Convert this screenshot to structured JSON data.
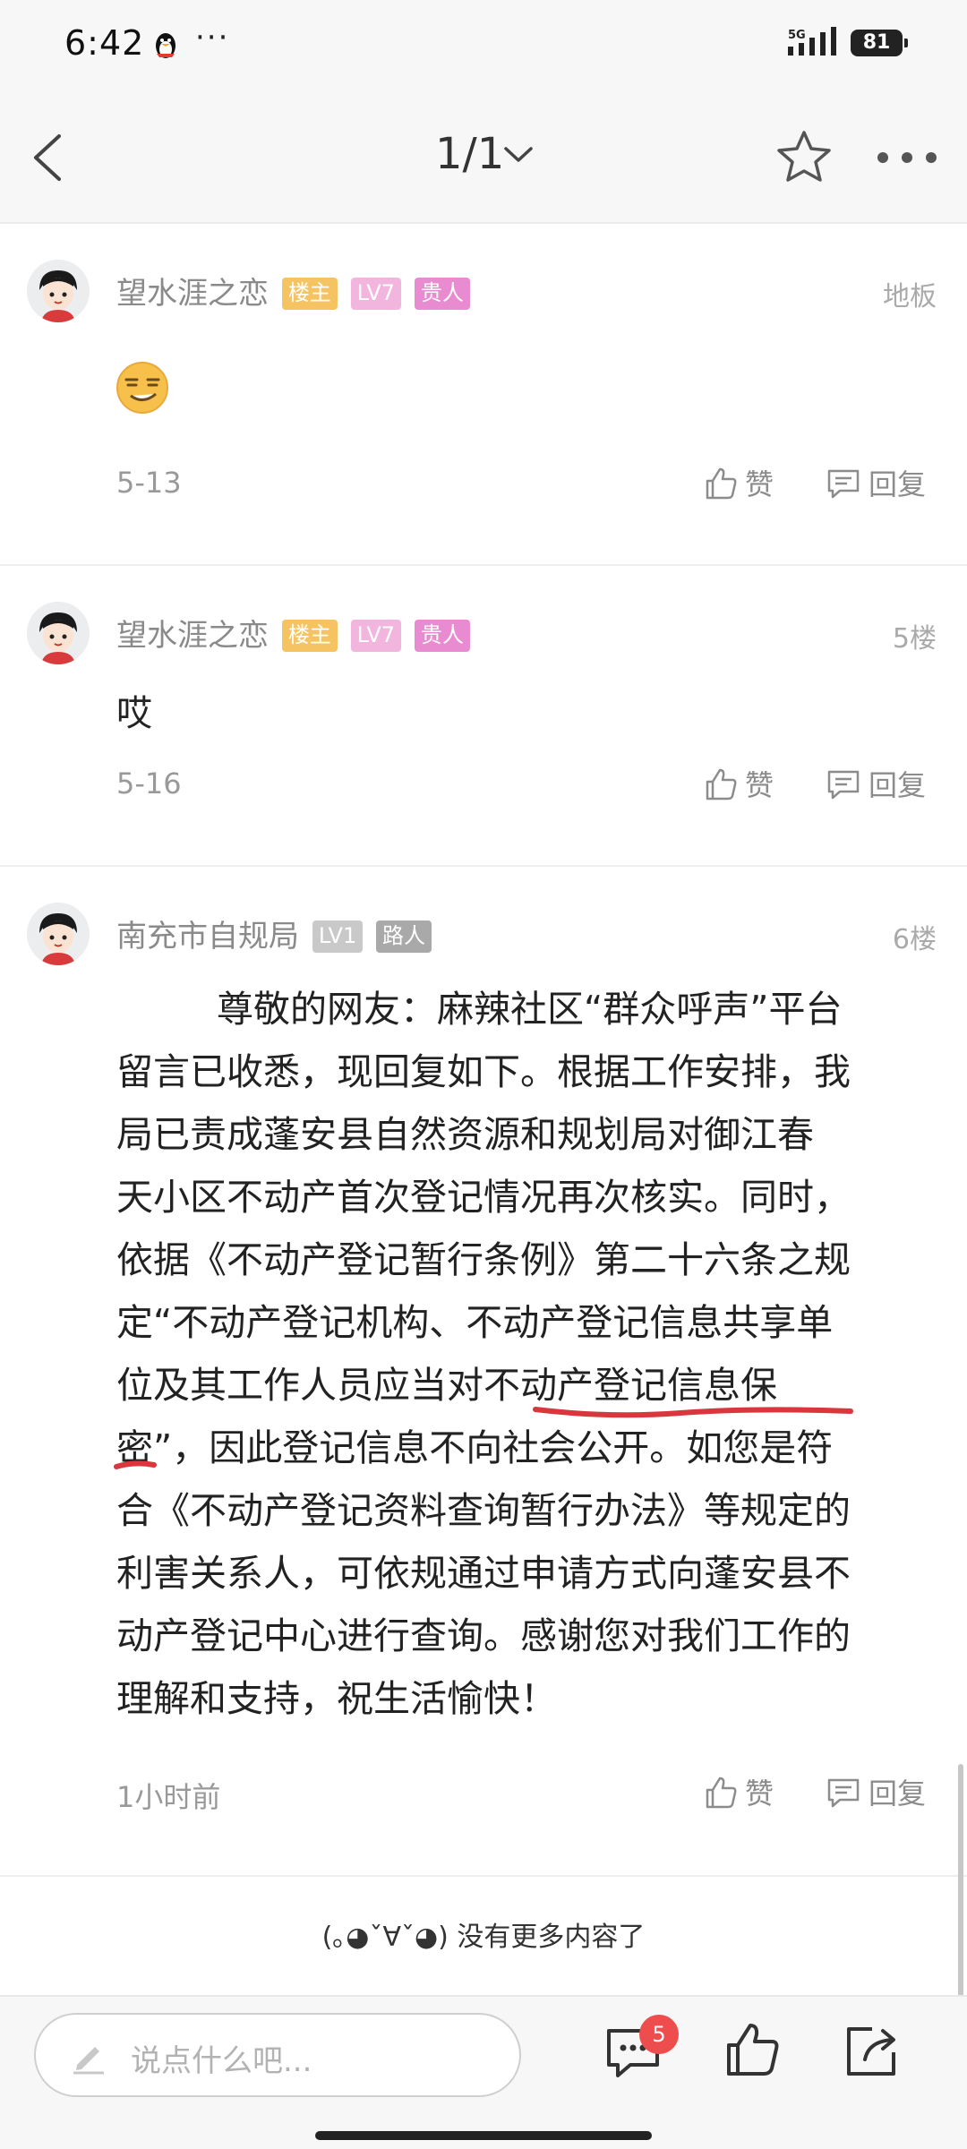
{
  "status_bar": {
    "time": "6:42",
    "network": "5G",
    "battery": "81"
  },
  "nav": {
    "page_indicator": "1/1"
  },
  "posts": [
    {
      "username": "望水涯之恋",
      "badges": [
        "楼主",
        "LV7",
        "贵人"
      ],
      "floor": "地板",
      "content_type": "emoji",
      "emoji": "smirk-emoji",
      "date": "5-13",
      "like_label": "赞",
      "reply_label": "回复"
    },
    {
      "username": "望水涯之恋",
      "badges": [
        "楼主",
        "LV7",
        "贵人"
      ],
      "floor": "5楼",
      "content": "哎",
      "date": "5-16",
      "like_label": "赞",
      "reply_label": "回复"
    },
    {
      "username": "南充市自规局",
      "badges": [
        "LV1",
        "路人"
      ],
      "floor": "6楼",
      "lines": [
        "尊敬的网友：麻辣社区“群众呼声”平台",
        "留言已收悉，现回复如下。根据工作安排，我",
        "局已责成蓬安县自然资源和规划局对御江春",
        "天小区不动产首次登记情况再次核实。同时，",
        "依据《不动产登记暂行条例》第二十六条之规",
        "定“不动产登记机构、不动产登记信息共享单",
        "位及其工作人员应当对不动产登记信息保",
        "密”，因此登记信息不向社会公开。如您是符",
        "合《不动产登记资料查询暂行办法》等规定的",
        "利害关系人，可依规通过申请方式向蓬安县不",
        "动产登记中心进行查询。感谢您对我们工作的",
        "理解和支持，祝生活愉快！"
      ],
      "date": "1小时前",
      "like_label": "赞",
      "reply_label": "回复"
    }
  ],
  "footer_note": "(｡◕ˇ∀ˇ◕) 没有更多内容了",
  "bottom_bar": {
    "input_placeholder": "说点什么吧...",
    "comment_count": "5"
  },
  "colors": {
    "accent_red": "#ee4d4d",
    "badge_owner": "#f5c361",
    "badge_rank": "#e98bd1",
    "underline": "#d9363e"
  }
}
